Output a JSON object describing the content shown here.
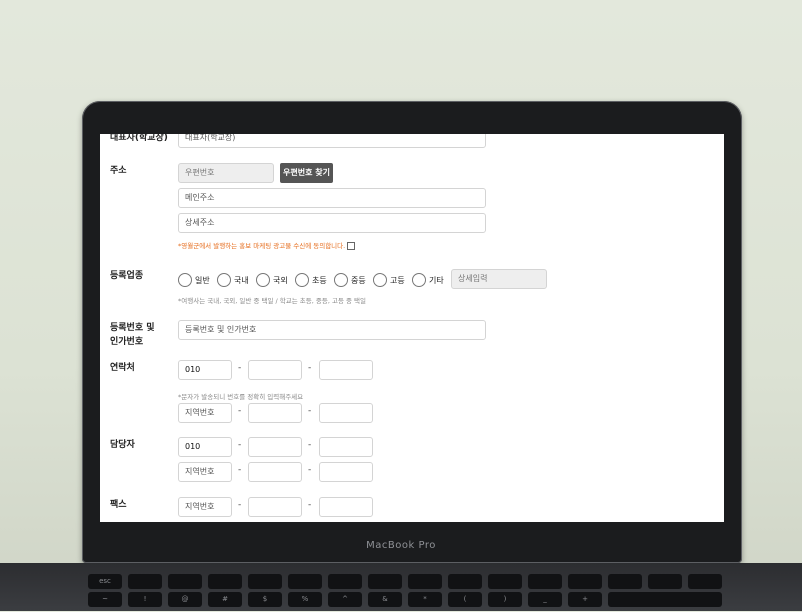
{
  "laptop": {
    "brand": "MacBook Pro"
  },
  "form": {
    "representative": {
      "label": "대표자(학교장)",
      "value": "대표자(학교장)"
    },
    "address": {
      "label": "주소",
      "postal_placeholder": "우편번호",
      "find_button": "우편번호 찾기",
      "main_placeholder": "메인주소",
      "detail_placeholder": "상세주소",
      "consent_note": "*영월군에서 발행하는 홍보 마케팅 광고물 수신에 동의합니다."
    },
    "registration_type": {
      "label": "등록업종",
      "options": [
        "일반",
        "국내",
        "국외",
        "초등",
        "중등",
        "고등",
        "기타"
      ],
      "detail_placeholder": "상세입력",
      "note": "*여행사는 국내, 국외, 일반 중 택일 / 학교는 초등, 중등, 고등 중 택일"
    },
    "registration_number": {
      "label_line1": "등록번호 및",
      "label_line2": "인가번호",
      "placeholder": "등록번호 및 인가번호"
    },
    "contact": {
      "label": "연락처",
      "mobile_prefix": "010",
      "note": "*문자가 발송되니 번호를 정확히 입력해주세요",
      "area_placeholder": "지역번호"
    },
    "manager": {
      "label": "담당자",
      "mobile_prefix": "010",
      "area_placeholder": "지역번호"
    },
    "fax": {
      "label": "팩스",
      "area_placeholder": "지역번호"
    },
    "dash": "-"
  },
  "keyboard": {
    "row1": [
      "esc",
      "",
      "",
      "",
      "",
      "",
      "",
      "",
      "",
      "",
      "",
      "",
      "",
      ""
    ],
    "row2": [
      "~",
      "!",
      "@",
      "#",
      "$",
      "%",
      "^",
      "&",
      "*",
      "(",
      ")",
      "_",
      "+",
      ""
    ]
  }
}
